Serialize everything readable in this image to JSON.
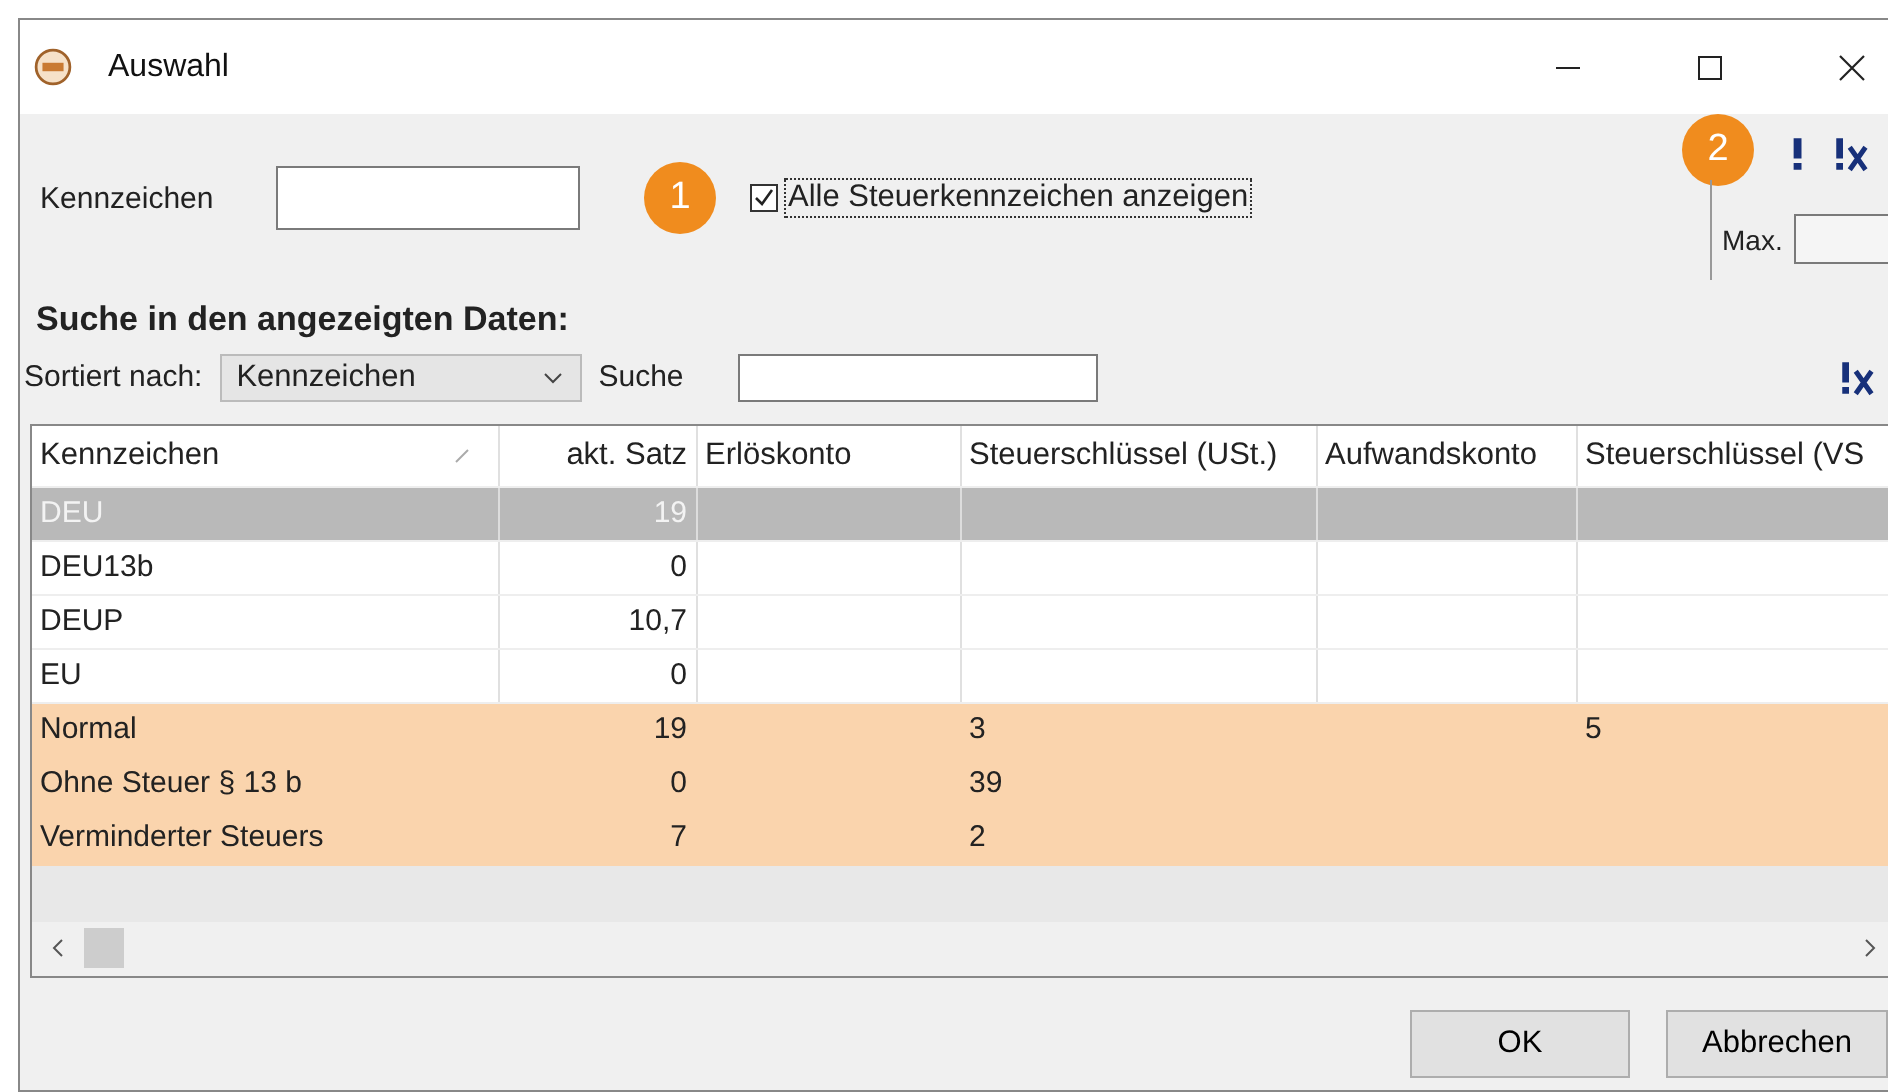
{
  "window": {
    "title": "Auswahl"
  },
  "filter": {
    "label": "Kennzeichen",
    "badge": "1",
    "checkbox": {
      "label": "Alle Steuerkennzeichen anzeigen",
      "checked": true
    }
  },
  "limit": {
    "badge": "2",
    "label": "Max."
  },
  "search_heading": "Suche in den angezeigten Daten:",
  "sort": {
    "label": "Sortiert nach:",
    "value": "Kennzeichen"
  },
  "search": {
    "label": "Suche"
  },
  "table": {
    "columns": [
      {
        "label": "Kennzeichen",
        "sorted": true
      },
      {
        "label": "akt. Satz",
        "sorted": false
      },
      {
        "label": "Erlöskonto",
        "sorted": false
      },
      {
        "label": "Steuerschlüssel (USt.)",
        "sorted": false
      },
      {
        "label": "Aufwandskonto",
        "sorted": false
      },
      {
        "label": "Steuerschlüssel (VS",
        "sorted": false
      }
    ],
    "rows": [
      {
        "cells": [
          "DEU",
          "19",
          "",
          "",
          "",
          ""
        ],
        "selected": true,
        "highlighted": false
      },
      {
        "cells": [
          "DEU13b",
          "0",
          "",
          "",
          "",
          ""
        ],
        "selected": false,
        "highlighted": false
      },
      {
        "cells": [
          "DEUP",
          "10,7",
          "",
          "",
          "",
          ""
        ],
        "selected": false,
        "highlighted": false
      },
      {
        "cells": [
          "EU",
          "0",
          "",
          "",
          "",
          ""
        ],
        "selected": false,
        "highlighted": false
      },
      {
        "cells": [
          "Normal",
          "19",
          "",
          "3",
          "",
          "5"
        ],
        "selected": false,
        "highlighted": true
      },
      {
        "cells": [
          "Ohne Steuer § 13 b",
          "0",
          "",
          "39",
          "",
          ""
        ],
        "selected": false,
        "highlighted": true
      },
      {
        "cells": [
          "Verminderter Steuers",
          "7",
          "",
          "2",
          "",
          ""
        ],
        "selected": false,
        "highlighted": true
      }
    ]
  },
  "buttons": [
    "OK",
    "Abbrechen"
  ]
}
